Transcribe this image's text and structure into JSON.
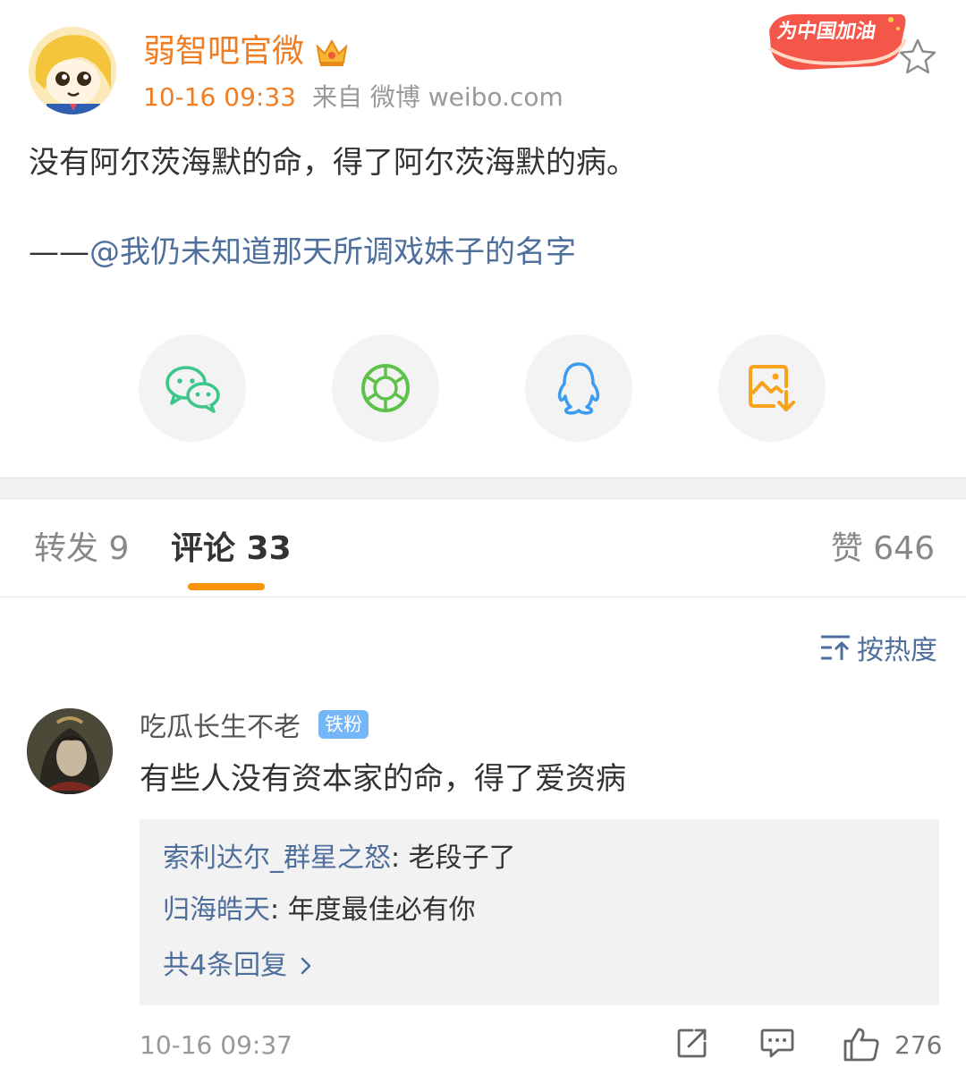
{
  "post": {
    "author_name": "弱智吧官微",
    "time": "10-16 09:33",
    "source": "来自 微博 weibo.com",
    "badge_text": "为中国加油",
    "text": "没有阿尔茨海默的命，得了阿尔茨海默的病。",
    "quote_dash": "——",
    "quote_mention": "@我仍未知道那天所调戏妹子的名字"
  },
  "share_icons": [
    "wechat-icon",
    "moments-icon",
    "qq-icon",
    "save-image-icon"
  ],
  "tabs": {
    "repost": "转发 9",
    "comment": "评论 33",
    "like": "赞 646"
  },
  "sort": {
    "label": "按热度"
  },
  "comment": {
    "user": "吃瓜长生不老",
    "badge": "铁粉",
    "text": "有些人没有资本家的命，得了爱资病",
    "replies": [
      {
        "user": "索利达尔_群星之怒",
        "sep": ": ",
        "text": "老段子了"
      },
      {
        "user": "归海皓天",
        "sep": ": ",
        "text": "年度最佳必有你"
      }
    ],
    "more_replies": "共4条回复",
    "time": "10-16 09:37",
    "like_count": "276"
  },
  "colors": {
    "accent_orange": "#f07d22",
    "link_blue": "#4e6e9c",
    "tab_indicator": "#f7940a",
    "wechat_green": "#3cc68a",
    "qq_blue": "#3a9cf0",
    "save_orange": "#f7a21b"
  }
}
